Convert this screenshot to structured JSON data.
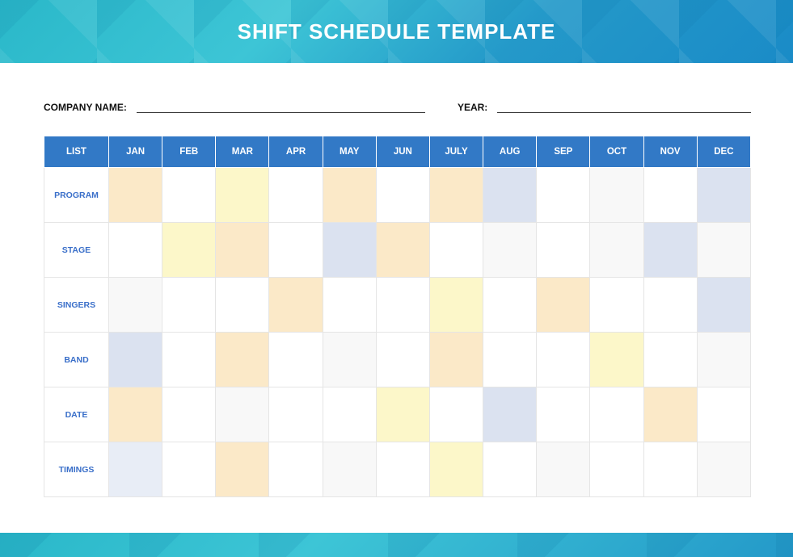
{
  "header": {
    "title": "SHIFT SCHEDULE TEMPLATE"
  },
  "fields": {
    "company": {
      "label": "COMPANY NAME:",
      "value": ""
    },
    "year": {
      "label": "YEAR:",
      "value": ""
    }
  },
  "table": {
    "headers": [
      "LIST",
      "JAN",
      "FEB",
      "MAR",
      "APR",
      "MAY",
      "JUN",
      "JULY",
      "AUG",
      "SEP",
      "OCT",
      "NOV",
      "DEC"
    ],
    "rows": [
      {
        "label": "PROGRAM",
        "cells": [
          "orange",
          "white",
          "yellow",
          "white",
          "orange",
          "white",
          "orange",
          "blue",
          "white",
          "grey",
          "white",
          "blue"
        ]
      },
      {
        "label": "STAGE",
        "cells": [
          "white",
          "yellow",
          "orange",
          "white",
          "blue",
          "orange",
          "white",
          "grey",
          "white",
          "grey",
          "blue",
          "grey"
        ]
      },
      {
        "label": "SINGERS",
        "cells": [
          "grey",
          "white",
          "white",
          "orange",
          "white",
          "white",
          "yellow",
          "white",
          "orange",
          "white",
          "white",
          "blue"
        ]
      },
      {
        "label": "BAND",
        "cells": [
          "blue",
          "white",
          "orange",
          "white",
          "grey",
          "white",
          "orange",
          "white",
          "white",
          "yellow",
          "white",
          "grey"
        ]
      },
      {
        "label": "DATE",
        "cells": [
          "orange",
          "white",
          "grey",
          "white",
          "white",
          "yellow",
          "white",
          "blue",
          "white",
          "white",
          "orange",
          "white"
        ]
      },
      {
        "label": "TIMINGS",
        "cells": [
          "blue2",
          "white",
          "orange",
          "white",
          "grey",
          "white",
          "yellow",
          "white",
          "grey",
          "white",
          "white",
          "grey"
        ]
      }
    ]
  },
  "colors": {
    "blue": "#dbe2f0",
    "blue2": "#e8edf6",
    "yellow": "#fcf7c9",
    "orange": "#fbe9c8",
    "grey": "#f8f8f8",
    "white": "#ffffff"
  }
}
